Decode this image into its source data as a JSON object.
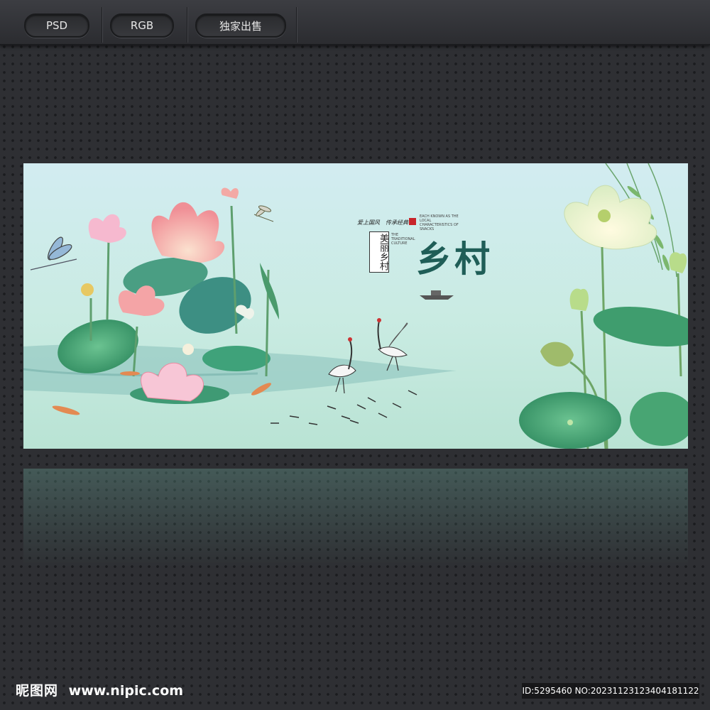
{
  "toolbar": {
    "buttons": [
      {
        "label": "PSD"
      },
      {
        "label": "RGB"
      },
      {
        "label": "独家出售"
      }
    ]
  },
  "poster": {
    "title": "乡村",
    "vertical_label": "美丽乡村",
    "slogan_left": "爱上国风",
    "slogan_right": "传承经典",
    "english_block": "EACH KNOWN AS THE LOCAL CHARACTERISTICS OF SNACKS",
    "english_block_2": "THE TRADITIONAL CULTURE"
  },
  "footer": {
    "logo_cn": "昵图网",
    "logo_url": "www.nipic.com",
    "id_text": "ID:5295460 NO:20231123123404181122"
  },
  "colors": {
    "page_bg": "#2e2f33",
    "title_green": "#1f5e57",
    "lotus_pink": "#f2a5a8",
    "leaf_green": "#3f9d6e"
  }
}
